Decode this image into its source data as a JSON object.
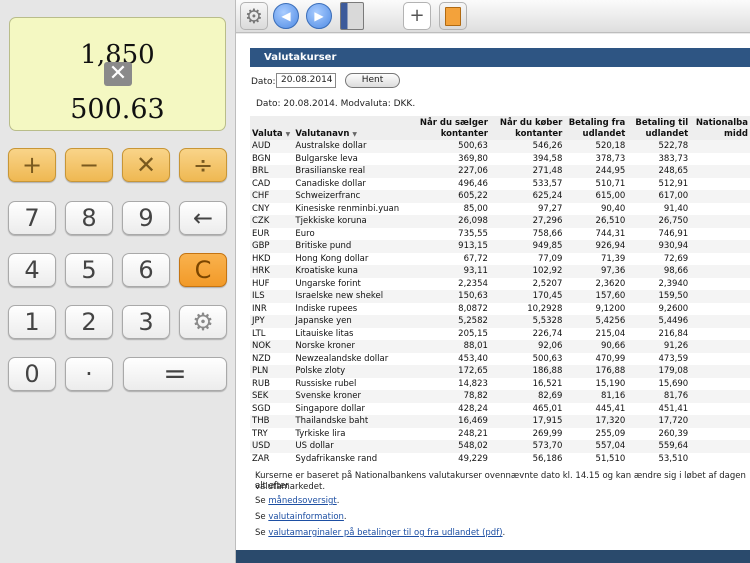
{
  "calculator": {
    "display_top": "1,850",
    "display_operator": "✕",
    "display_bottom": "500.63",
    "keys": {
      "plus": "+",
      "minus": "−",
      "times": "✕",
      "divide": "÷",
      "seven": "7",
      "eight": "8",
      "nine": "9",
      "backspace": "←",
      "four": "4",
      "five": "5",
      "six": "6",
      "clear": "C",
      "one": "1",
      "two": "2",
      "three": "3",
      "settings": "⚙",
      "zero": "0",
      "decimal": "·",
      "equals": "="
    }
  },
  "toolbar": {
    "gear": "⚙",
    "back": "◀",
    "forward": "▶",
    "plus": "+"
  },
  "page": {
    "title": "Valutakurser",
    "date_label": "Dato:",
    "date_value": "20.08.2014",
    "fetch_label": "Hent",
    "info_line": "Dato: 20.08.2014. Modvaluta: DKK.",
    "headers": {
      "code": "Valuta",
      "name": "Valutanavn",
      "sell_1": "Når du sælger",
      "sell_2": "kontanter",
      "buy_1": "Når du køber",
      "buy_2": "kontanter",
      "payfrom_1": "Betaling fra",
      "payfrom_2": "udlandet",
      "payto_1": "Betaling til",
      "payto_2": "udlandet",
      "mid_1": "Nationalba",
      "mid_2": "midd"
    },
    "rows": [
      [
        "AUD",
        "Australske dollar",
        "500,63",
        "546,26",
        "520,18",
        "522,78"
      ],
      [
        "BGN",
        "Bulgarske leva",
        "369,80",
        "394,58",
        "378,73",
        "383,73"
      ],
      [
        "BRL",
        "Brasilianske real",
        "227,06",
        "271,48",
        "244,95",
        "248,65"
      ],
      [
        "CAD",
        "Canadiske dollar",
        "496,46",
        "533,57",
        "510,71",
        "512,91"
      ],
      [
        "CHF",
        "Schweizerfranc",
        "605,22",
        "625,24",
        "615,00",
        "617,00"
      ],
      [
        "CNY",
        "Kinesiske renminbi.yuan",
        "85,00",
        "97,27",
        "90,40",
        "91,40"
      ],
      [
        "CZK",
        "Tjekkiske koruna",
        "26,098",
        "27,296",
        "26,510",
        "26,750"
      ],
      [
        "EUR",
        "Euro",
        "735,55",
        "758,66",
        "744,31",
        "746,91"
      ],
      [
        "GBP",
        "Britiske pund",
        "913,15",
        "949,85",
        "926,94",
        "930,94"
      ],
      [
        "HKD",
        "Hong Kong dollar",
        "67,72",
        "77,09",
        "71,39",
        "72,69"
      ],
      [
        "HRK",
        "Kroatiske kuna",
        "93,11",
        "102,92",
        "97,36",
        "98,66"
      ],
      [
        "HUF",
        "Ungarske forint",
        "2,2354",
        "2,5207",
        "2,3620",
        "2,3940"
      ],
      [
        "ILS",
        "Israelske new shekel",
        "150,63",
        "170,45",
        "157,60",
        "159,50"
      ],
      [
        "INR",
        "Indiske rupees",
        "8,0872",
        "10,2928",
        "9,1200",
        "9,2600"
      ],
      [
        "JPY",
        "Japanske yen",
        "5,2582",
        "5,5328",
        "5,4256",
        "5,4496"
      ],
      [
        "LTL",
        "Litauiske litas",
        "205,15",
        "226,74",
        "215,04",
        "216,84"
      ],
      [
        "NOK",
        "Norske kroner",
        "88,01",
        "92,06",
        "90,66",
        "91,26"
      ],
      [
        "NZD",
        "Newzealandske dollar",
        "453,40",
        "500,63",
        "470,99",
        "473,59"
      ],
      [
        "PLN",
        "Polske zloty",
        "172,65",
        "186,88",
        "176,88",
        "179,08"
      ],
      [
        "RUB",
        "Russiske rubel",
        "14,823",
        "16,521",
        "15,190",
        "15,690"
      ],
      [
        "SEK",
        "Svenske kroner",
        "78,82",
        "82,69",
        "81,16",
        "81,76"
      ],
      [
        "SGD",
        "Singapore dollar",
        "428,24",
        "465,01",
        "445,41",
        "451,41"
      ],
      [
        "THB",
        "Thailandske baht",
        "16,469",
        "17,915",
        "17,320",
        "17,720"
      ],
      [
        "TRY",
        "Tyrkiske lira",
        "248,21",
        "269,99",
        "255,09",
        "260,39"
      ],
      [
        "USD",
        "US dollar",
        "548,02",
        "573,70",
        "557,04",
        "559,64"
      ],
      [
        "ZAR",
        "Sydafrikanske rand",
        "49,229",
        "56,186",
        "51,510",
        "53,510"
      ]
    ],
    "footer": {
      "note": "Kurserne er baseret på Nationalbankens valutakurser ovennævnte dato kl. 14.15 og kan ændre sig i løbet af dagen alt efter",
      "note_2": "valutamarkedet.",
      "see": "Se",
      "link_monthly": "månedsoversigt",
      "link_info": "valutainformation",
      "link_margins": "valutamarginaler på betalinger til og fra udlandet (pdf)"
    }
  }
}
